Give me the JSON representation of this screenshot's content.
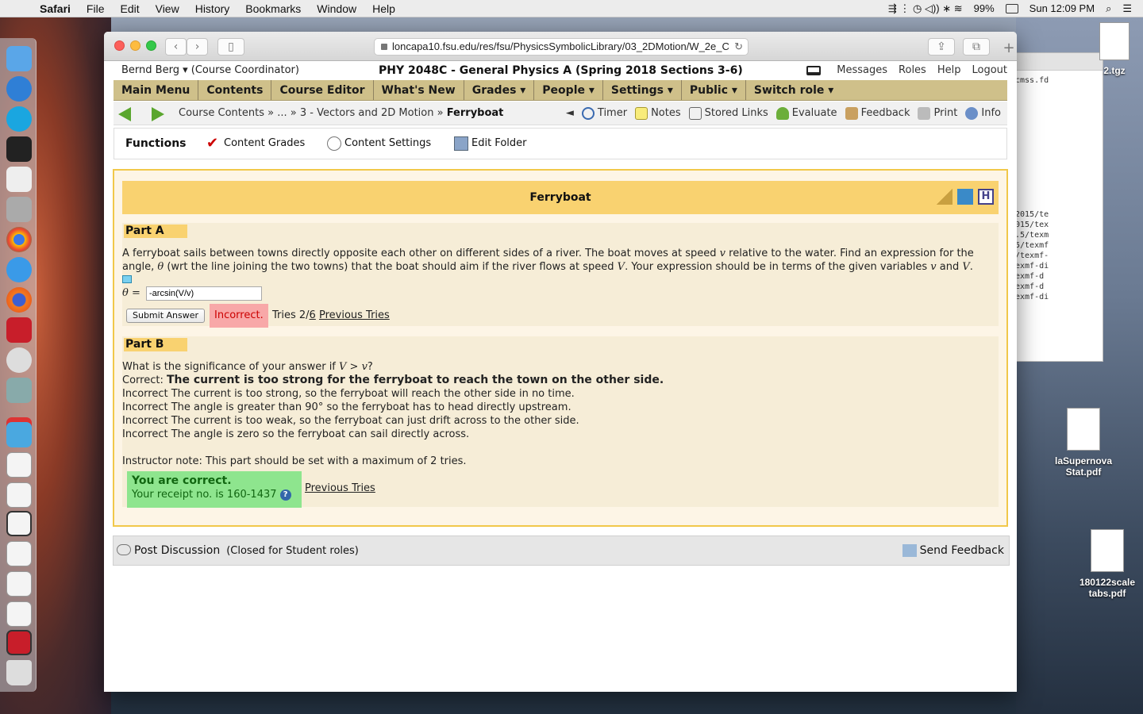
{
  "menubar": {
    "app": "Safari",
    "items": [
      "File",
      "Edit",
      "View",
      "History",
      "Bookmarks",
      "Window",
      "Help"
    ],
    "battery": "99%",
    "clock": "Sun 12:09 PM"
  },
  "browser": {
    "url": "loncapa10.fsu.edu/res/fsu/PhysicsSymbolicLibrary/03_2DMotion/W_2e_C"
  },
  "header": {
    "user": "Bernd Berg ▾",
    "role": "(Course Coordinator)",
    "course_title": "PHY 2048C - General Physics A (Spring 2018 Sections 3-6)",
    "links": [
      "Messages",
      "Roles",
      "Help",
      "Logout"
    ]
  },
  "main_nav": [
    "Main Menu",
    "Contents",
    "Course Editor",
    "What's New",
    "Grades ▾",
    "People ▾",
    "Settings ▾",
    "Public ▾",
    "Switch role ▾"
  ],
  "breadcrumb": {
    "part1": "Course Contents",
    "sep": " » ... » ",
    "part2": "3 - Vectors and 2D Motion",
    "sep2": " » ",
    "current": "Ferryboat"
  },
  "tools": {
    "collapse": "◄",
    "timer": "Timer",
    "notes": "Notes",
    "stored_links": "Stored Links",
    "evaluate": "Evaluate",
    "feedback": "Feedback",
    "print": "Print",
    "info": "Info"
  },
  "functions": {
    "title": "Functions",
    "content_grades": "Content Grades",
    "content_settings": "Content Settings",
    "edit_folder": "Edit Folder"
  },
  "problem": {
    "title": "Ferryboat",
    "part_a": {
      "label": "Part A",
      "line1": "A ferryboat sails between towns directly opposite each other on different sides of a river. The boat moves at speed",
      "v": "v",
      "line1b": "relative to the water. Find an expression for the",
      "line2a": "angle,",
      "theta": "θ",
      "line2b": "(wrt the line joining the two towns) that the boat should aim if the river flows at speed",
      "V": "V",
      "line2c": ". Your expression should be in terms of the given variables",
      "v2": "v",
      "and": "and",
      "V2": "V",
      "dot": ".",
      "answer_label": "θ =",
      "answer_value": "-arcsin(V/v)",
      "submit_label": "Submit Answer",
      "status": "Incorrect.",
      "tries_text": "Tries 2/",
      "tries_max": "6",
      "previous_tries": "Previous Tries"
    },
    "part_b": {
      "label": "Part B",
      "question_a": "What is the significance of your answer if",
      "question_math": "V > v",
      "question_b": "?",
      "correct_prefix": "Correct:",
      "correct_text": "The current is too strong for the ferryboat to reach the town on the other side.",
      "incorrect": [
        "Incorrect The current is too strong, so the ferryboat will reach the other side in no time.",
        "Incorrect The angle is greater than 90° so the ferryboat has to head directly upstream.",
        "Incorrect The current is too weak, so the ferryboat can just drift across to the other side.",
        "Incorrect The angle is zero so the ferryboat can sail directly across."
      ],
      "instructor_note": "Instructor note: This part should be set with a maximum of 2 tries.",
      "result_title": "You are correct.",
      "receipt": "Your receipt no. is 160-1437",
      "help_glyph": "?",
      "previous_tries": "Previous Tries"
    }
  },
  "discussion": {
    "post": "Post Discussion",
    "closed": "(Closed for Student roles)",
    "send_feedback": "Send Feedback"
  },
  "desktop": {
    "back_window_lines": "cmss.fd\n\n\n\n\n\n\n\n\n\n\n\n\n2015/te\n015/tex\n.5/texm\n5/texmf\n/texmf-\nexmf-di\nexmf-d\nexmf-d\nexmf-di",
    "icon1": "laSupernova Stat.pdf",
    "icon2": "180122scale tabs.pdf",
    "tgz": "2.tgz"
  },
  "colors": {
    "nav_bg": "#cfc08a",
    "title_bg": "#f9d270",
    "incorrect_bg": "#f8a8a8",
    "correct_bg": "#8ee58e"
  }
}
